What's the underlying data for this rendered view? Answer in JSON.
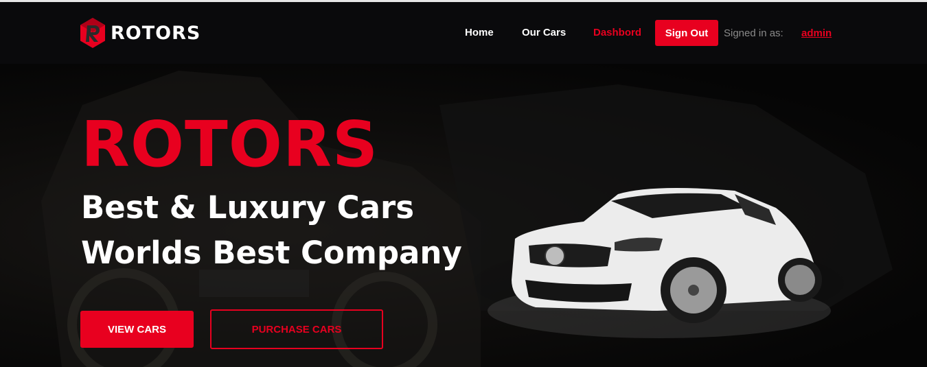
{
  "brand": {
    "logo_text": "ROTORS"
  },
  "nav": {
    "home": "Home",
    "our_cars": "Our Cars",
    "dashboard": "Dashbord",
    "sign_out": "Sign Out",
    "signed_in_label": "Signed in as:",
    "username": "admin"
  },
  "hero": {
    "brand": "ROTORS",
    "line1": "Best & Luxury Cars",
    "line2": "Worlds Best Company",
    "view_cars": "VIEW CARS",
    "purchase_cars": "PURCHASE CARS"
  },
  "colors": {
    "accent": "#e8001f",
    "navbar": "#0a0a0c",
    "background": "#000000",
    "muted_text": "#8a8a8a"
  }
}
